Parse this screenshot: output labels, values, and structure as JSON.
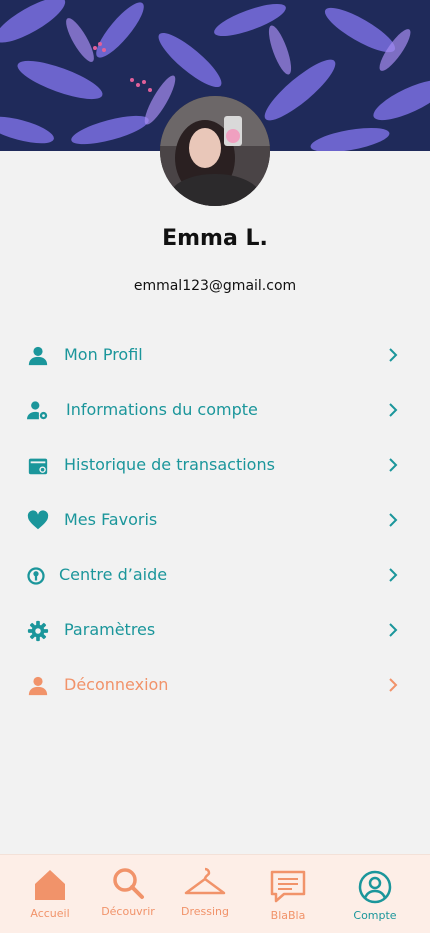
{
  "profile": {
    "name": "Emma L.",
    "email": "emmal123@gmail.com"
  },
  "menu": {
    "items": [
      {
        "label": "Mon Profil",
        "icon": "person-icon"
      },
      {
        "label": "Informations du compte",
        "icon": "person-gear-icon"
      },
      {
        "label": "Historique de transactions",
        "icon": "wallet-icon"
      },
      {
        "label": "Mes Favoris",
        "icon": "heart-icon"
      },
      {
        "label": "Centre d’aide",
        "icon": "help-icon"
      },
      {
        "label": "Paramètres",
        "icon": "gear-icon"
      },
      {
        "label": "Déconnexion",
        "icon": "person-icon"
      }
    ]
  },
  "nav": {
    "items": [
      {
        "label": "Accueil",
        "icon": "home-icon"
      },
      {
        "label": "Découvrir",
        "icon": "search-icon"
      },
      {
        "label": "Dressing",
        "icon": "hanger-icon"
      },
      {
        "label": "BlaBla",
        "icon": "chat-icon"
      },
      {
        "label": "Compte",
        "icon": "account-icon"
      }
    ]
  },
  "colors": {
    "accent": "#1b969b",
    "logout": "#f1936a",
    "banner_bg": "#1f2a5a",
    "nav_bg": "#fdeee7"
  }
}
